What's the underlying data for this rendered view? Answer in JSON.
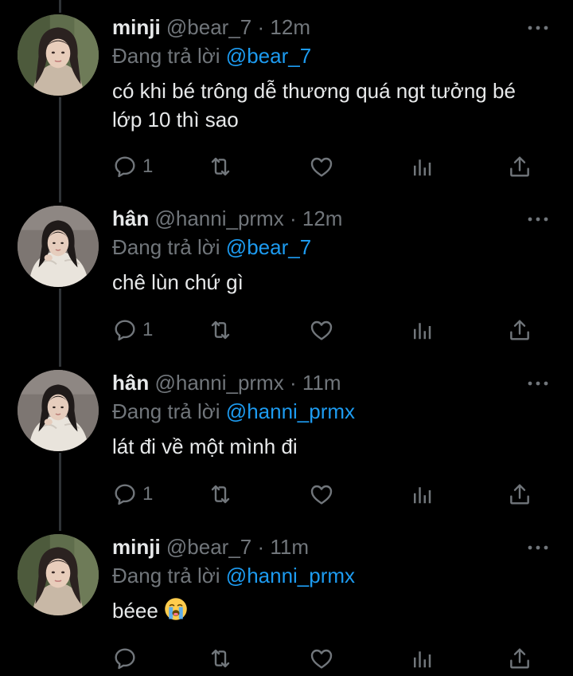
{
  "theme": {
    "background": "#000000",
    "text": "#e7e9ea",
    "muted": "#71767b",
    "accent": "#1d9bf0"
  },
  "tweets": [
    {
      "name": "minji",
      "handle": "@bear_7",
      "separator": "·",
      "time": "12m",
      "replying_prefix": "Đang trả lời",
      "replying_to": "@bear_7",
      "text": "có khi bé trông dễ thương quá ngt tưởng bé lớp 10 thì sao",
      "reply_count": "1",
      "avatar": "avatar-minji"
    },
    {
      "name": "hân",
      "handle": "@hanni_prmx",
      "separator": "·",
      "time": "12m",
      "replying_prefix": "Đang trả lời",
      "replying_to": "@bear_7",
      "text": "chê lùn chứ gì",
      "reply_count": "1",
      "avatar": "avatar-han"
    },
    {
      "name": "hân",
      "handle": "@hanni_prmx",
      "separator": "·",
      "time": "11m",
      "replying_prefix": "Đang trả lời",
      "replying_to": "@hanni_prmx",
      "text": "lát đi về một mình đi",
      "reply_count": "1",
      "avatar": "avatar-han"
    },
    {
      "name": "minji",
      "handle": "@bear_7",
      "separator": "·",
      "time": "11m",
      "replying_prefix": "Đang trả lời",
      "replying_to": "@hanni_prmx",
      "text": "béee",
      "emoji": "loudly-crying-face",
      "reply_count": "",
      "avatar": "avatar-minji"
    }
  ],
  "icons": {
    "reply": "reply-icon",
    "retweet": "retweet-icon",
    "like": "like-icon",
    "views": "views-icon",
    "share": "share-icon",
    "more": "more-icon"
  }
}
